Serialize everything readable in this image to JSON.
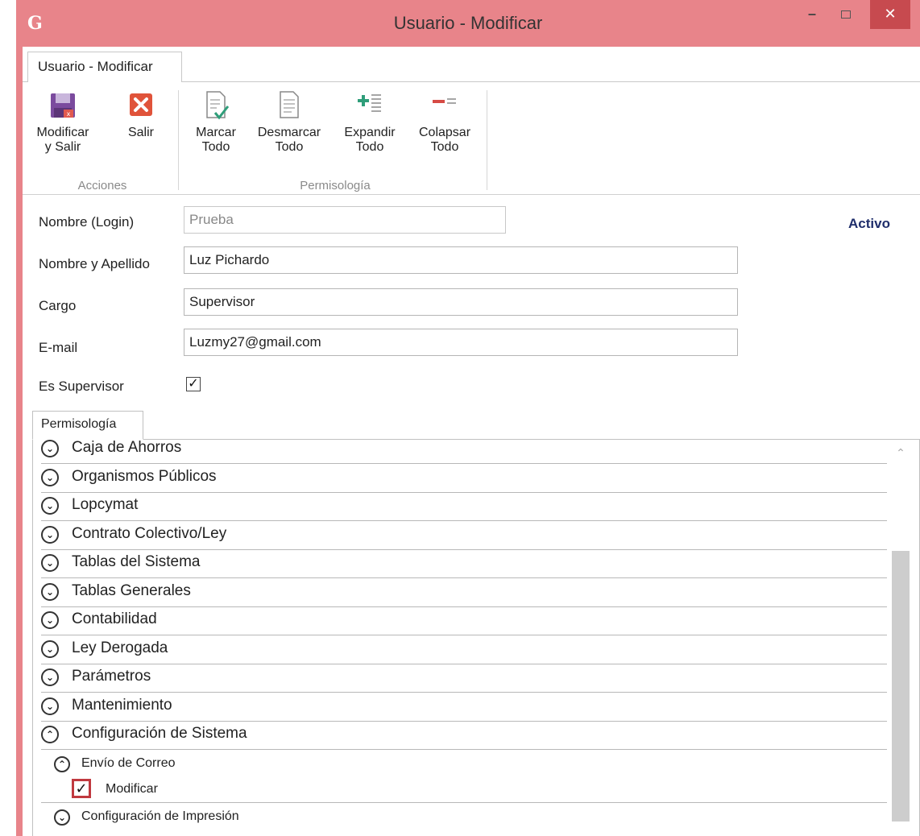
{
  "window": {
    "title": "Usuario - Modificar",
    "app_icon": "G",
    "minimize": "–",
    "close": "✕"
  },
  "ribbon": {
    "tab_label": "Usuario - Modificar",
    "groups": [
      {
        "label": "Acciones"
      },
      {
        "label": "Permisología"
      }
    ],
    "buttons": {
      "modificar_salir": {
        "line1": "Modificar",
        "line2": "y Salir",
        "icon": "save-icon"
      },
      "salir": {
        "line1": "Salir",
        "icon": "close-icon"
      },
      "marcar_todo": {
        "line1": "Marcar",
        "line2": "Todo",
        "icon": "check-document-icon"
      },
      "desmarcar_todo": {
        "line1": "Desmarcar",
        "line2": "Todo",
        "icon": "document-icon"
      },
      "expandir_todo": {
        "line1": "Expandir",
        "line2": "Todo",
        "icon": "expand-list-icon"
      },
      "colapsar_todo": {
        "line1": "Colapsar",
        "line2": "Todo",
        "icon": "collapse-list-icon"
      }
    }
  },
  "form": {
    "login": {
      "label": "Nombre (Login)",
      "value": "Prueba"
    },
    "fullname": {
      "label": "Nombre y Apellido",
      "value": "Luz Pichardo"
    },
    "cargo": {
      "label": "Cargo",
      "value": "Supervisor"
    },
    "email": {
      "label": "E-mail",
      "value": "Luzmy27@gmail.com"
    },
    "supervisor": {
      "label": "Es Supervisor",
      "checked": true
    },
    "status": "Activo"
  },
  "permisologia": {
    "tab_label": "Permisología",
    "items": [
      {
        "label": "Caja de Ahorros",
        "expanded": false
      },
      {
        "label": "Organismos Públicos",
        "expanded": false
      },
      {
        "label": "Lopcymat",
        "expanded": false
      },
      {
        "label": "Contrato Colectivo/Ley",
        "expanded": false
      },
      {
        "label": "Tablas del Sistema",
        "expanded": false
      },
      {
        "label": "Tablas Generales",
        "expanded": false
      },
      {
        "label": "Contabilidad",
        "expanded": false
      },
      {
        "label": "Ley Derogada",
        "expanded": false
      },
      {
        "label": "Parámetros",
        "expanded": false
      },
      {
        "label": "Mantenimiento",
        "expanded": false
      },
      {
        "label": "Configuración de Sistema",
        "expanded": true
      }
    ],
    "sub_items": [
      {
        "label": "Envío de Correo",
        "expanded": true
      },
      {
        "label": "Modificar",
        "checked": true
      },
      {
        "label": "Configuración de Impresión",
        "expanded": false
      }
    ]
  }
}
